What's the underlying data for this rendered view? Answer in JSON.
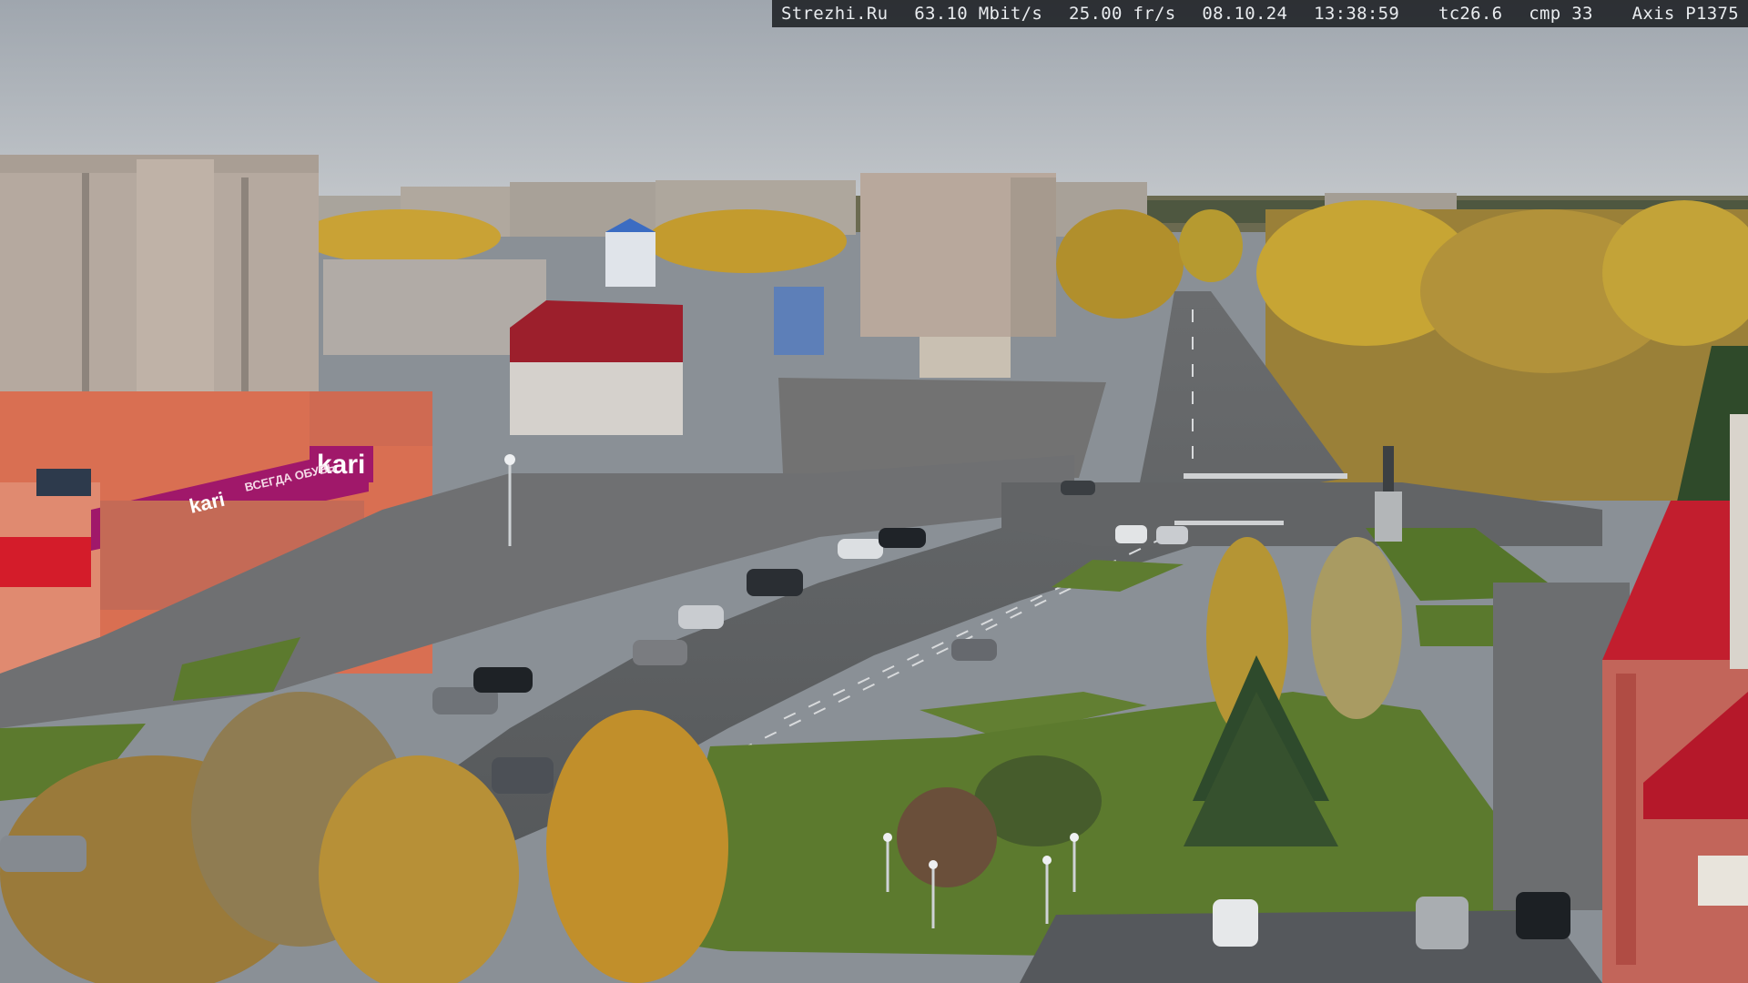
{
  "camera_overlay": {
    "site": "Strezhi.Ru",
    "bitrate": "63.10 Mbit/s",
    "framerate": "25.00 fr/s",
    "date": "08.10.24",
    "time": "13:38:59",
    "tc": "tc26.6",
    "cmp": "cmp 33",
    "camera_model": "Axis P1375"
  },
  "signs": {
    "store_logo": "kari",
    "store_logo_small": "kari",
    "store_banner": "ВСЕГДА ОБУВЬ"
  },
  "colors": {
    "sky": "#aeb4ba",
    "store_facade": "#e2826a",
    "store_banner": "#a0186a",
    "red_roof": "#c21e2e",
    "grass": "#5c7a2e",
    "asphalt": "#5a5c5e",
    "autumn_yellow": "#c8a028"
  }
}
